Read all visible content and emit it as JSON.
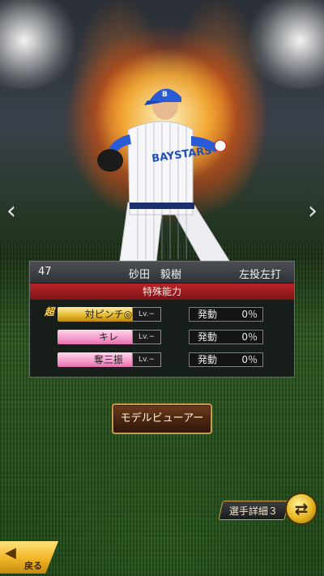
{
  "player": {
    "number": "47",
    "name": "砂田　毅樹",
    "bats_throws": "左投左打",
    "jersey_text": "BAYSTARS"
  },
  "abilities": {
    "header": "特殊能力",
    "super_prefix": "超",
    "items": [
      {
        "name": "対ピンチ◎",
        "level": "Lv.−",
        "activation_label": "発動",
        "activation_value": "0％",
        "color": "gold"
      },
      {
        "name": "キレ",
        "level": "Lv.−",
        "activation_label": "発動",
        "activation_value": "0％",
        "color": "pink"
      },
      {
        "name": "奪三振",
        "level": "Lv.−",
        "activation_label": "発動",
        "activation_value": "0％",
        "color": "pink"
      }
    ]
  },
  "buttons": {
    "model_viewer": "モデルビューアー",
    "player_detail": "選手詳細３",
    "back": "戻る"
  },
  "icons": {
    "prev": "chevron-left-icon",
    "next": "chevron-right-icon",
    "swap": "swap-arrows-icon"
  },
  "colors": {
    "ability_gold": "#e5b628",
    "ability_pink": "#f59bcb",
    "header_red": "#b8262a",
    "button_gold": "#f0b526"
  }
}
